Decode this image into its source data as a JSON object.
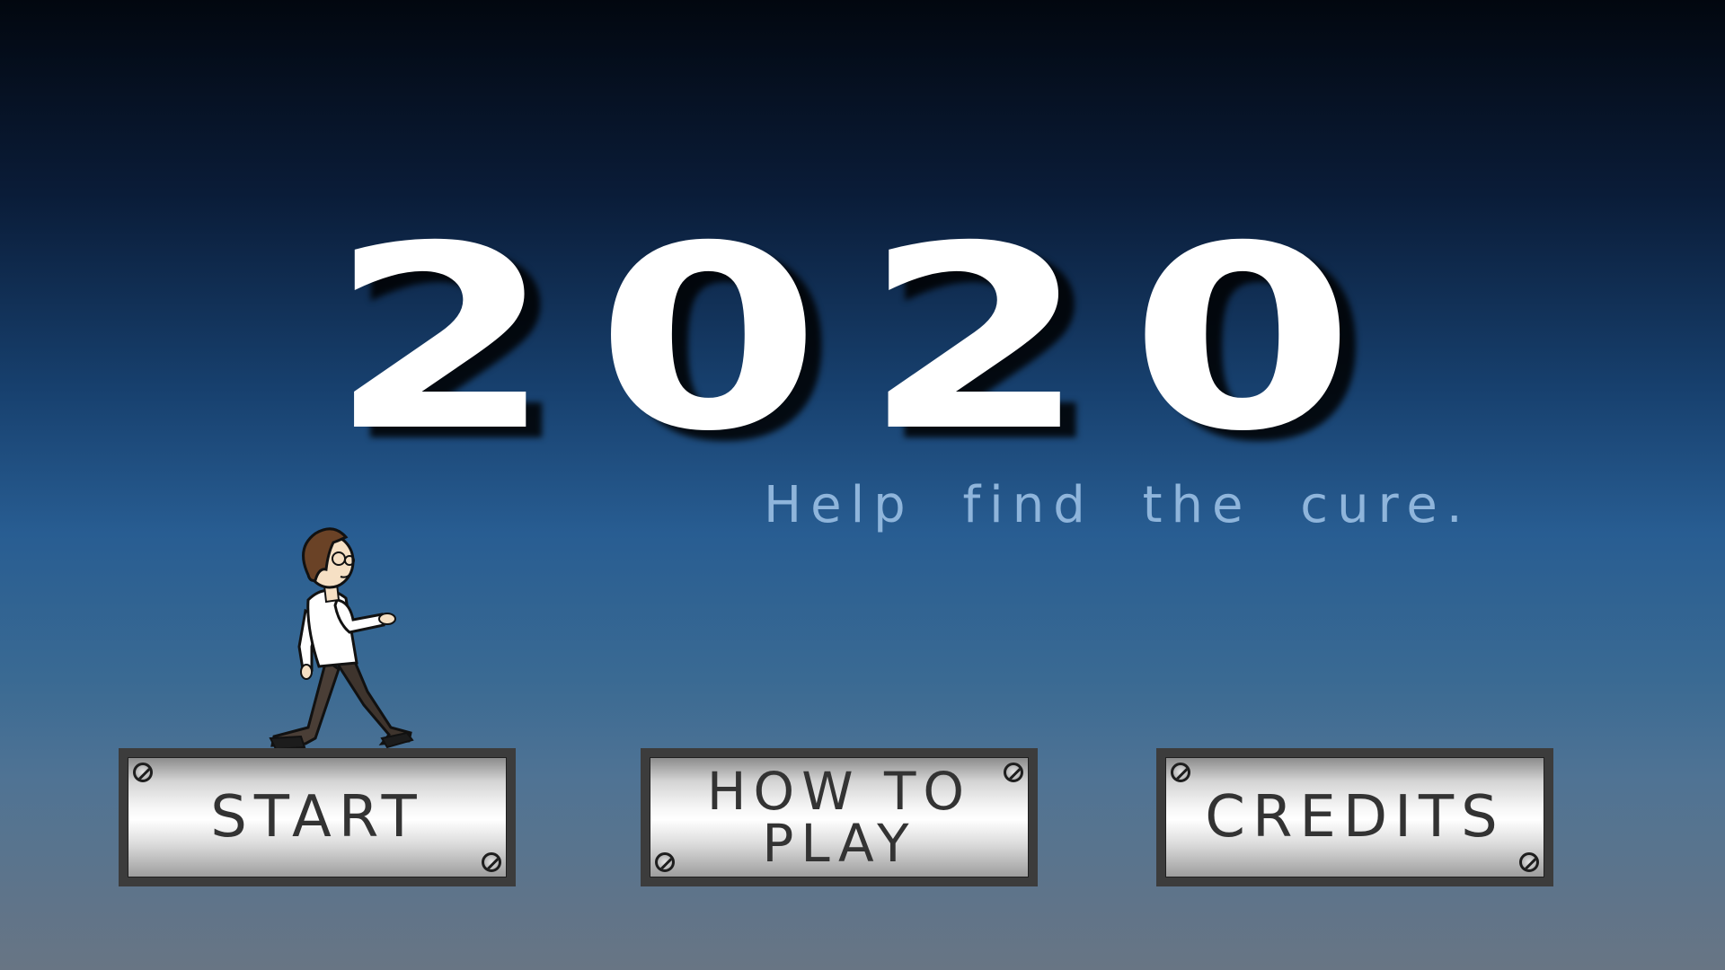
{
  "title": "2020",
  "tagline": "Help find the cure.",
  "menu": {
    "start_label": "START",
    "how_to_play_label": "HOW TO\nPLAY",
    "credits_label": "CREDITS"
  },
  "character": "walking-scientist",
  "colors": {
    "sky_top": "#02070f",
    "sky_middle": "#285d92",
    "sky_bottom": "#687584",
    "title": "#ffffff",
    "tagline": "#8fb5db",
    "button_frame": "#3c3c3c",
    "button_text": "#333333"
  }
}
